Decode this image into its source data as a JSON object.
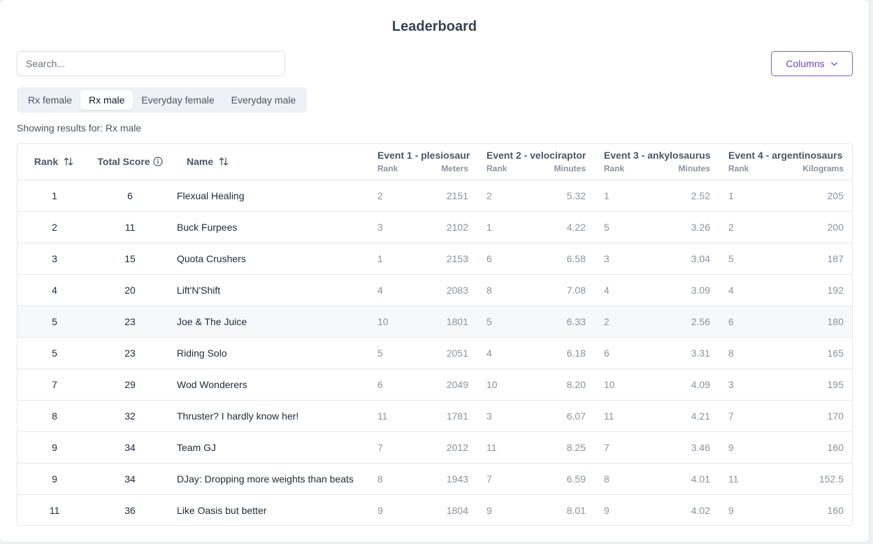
{
  "page": {
    "title": "Leaderboard"
  },
  "search": {
    "placeholder": "Search..."
  },
  "columns_button": {
    "label": "Columns"
  },
  "tabs": [
    {
      "label": "Rx female",
      "active": false
    },
    {
      "label": "Rx male",
      "active": true
    },
    {
      "label": "Everyday female",
      "active": false
    },
    {
      "label": "Everyday male",
      "active": false
    }
  ],
  "showing": "Showing results for: Rx male",
  "table": {
    "headers": {
      "rank": "Rank",
      "total_score": "Total Score",
      "name": "Name",
      "events": [
        {
          "title": "Event 1 - plesiosaur",
          "sub_left": "Rank",
          "sub_right": "Meters"
        },
        {
          "title": "Event 2 - velociraptor",
          "sub_left": "Rank",
          "sub_right": "Minutes"
        },
        {
          "title": "Event 3 - ankylosaurus",
          "sub_left": "Rank",
          "sub_right": "Minutes"
        },
        {
          "title": "Event 4 - argentinosaurs",
          "sub_left": "Rank",
          "sub_right": "Kilograms"
        }
      ]
    },
    "rows": [
      {
        "rank": "1",
        "score": "6",
        "name": "Flexual Healing",
        "events": [
          [
            "2",
            "2151"
          ],
          [
            "2",
            "5.32"
          ],
          [
            "1",
            "2.52"
          ],
          [
            "1",
            "205"
          ]
        ]
      },
      {
        "rank": "2",
        "score": "11",
        "name": "Buck Furpees",
        "events": [
          [
            "3",
            "2102"
          ],
          [
            "1",
            "4.22"
          ],
          [
            "5",
            "3.26"
          ],
          [
            "2",
            "200"
          ]
        ]
      },
      {
        "rank": "3",
        "score": "15",
        "name": "Quota Crushers",
        "events": [
          [
            "1",
            "2153"
          ],
          [
            "6",
            "6.58"
          ],
          [
            "3",
            "3.04"
          ],
          [
            "5",
            "187"
          ]
        ]
      },
      {
        "rank": "4",
        "score": "20",
        "name": "Lift'N'Shift",
        "events": [
          [
            "4",
            "2083"
          ],
          [
            "8",
            "7.08"
          ],
          [
            "4",
            "3.09"
          ],
          [
            "4",
            "192"
          ]
        ]
      },
      {
        "rank": "5",
        "score": "23",
        "name": "Joe & The Juice",
        "events": [
          [
            "10",
            "1801"
          ],
          [
            "5",
            "6.33"
          ],
          [
            "2",
            "2.56"
          ],
          [
            "6",
            "180"
          ]
        ]
      },
      {
        "rank": "5",
        "score": "23",
        "name": "Riding Solo",
        "events": [
          [
            "5",
            "2051"
          ],
          [
            "4",
            "6.18"
          ],
          [
            "6",
            "3.31"
          ],
          [
            "8",
            "165"
          ]
        ]
      },
      {
        "rank": "7",
        "score": "29",
        "name": "Wod Wonderers",
        "events": [
          [
            "6",
            "2049"
          ],
          [
            "10",
            "8.20"
          ],
          [
            "10",
            "4.09"
          ],
          [
            "3",
            "195"
          ]
        ]
      },
      {
        "rank": "8",
        "score": "32",
        "name": "Thruster? I hardly know her!",
        "events": [
          [
            "11",
            "1781"
          ],
          [
            "3",
            "6.07"
          ],
          [
            "11",
            "4.21"
          ],
          [
            "7",
            "170"
          ]
        ]
      },
      {
        "rank": "9",
        "score": "34",
        "name": "Team GJ",
        "events": [
          [
            "7",
            "2012"
          ],
          [
            "11",
            "8.25"
          ],
          [
            "7",
            "3.46"
          ],
          [
            "9",
            "160"
          ]
        ]
      },
      {
        "rank": "9",
        "score": "34",
        "name": "DJay: Dropping more weights than beats",
        "events": [
          [
            "8",
            "1943"
          ],
          [
            "7",
            "6.59"
          ],
          [
            "8",
            "4.01"
          ],
          [
            "11",
            "152.5"
          ]
        ]
      },
      {
        "rank": "11",
        "score": "36",
        "name": "Like Oasis but better",
        "events": [
          [
            "9",
            "1804"
          ],
          [
            "9",
            "8.01"
          ],
          [
            "9",
            "4.02"
          ],
          [
            "9",
            "160"
          ]
        ]
      }
    ]
  }
}
